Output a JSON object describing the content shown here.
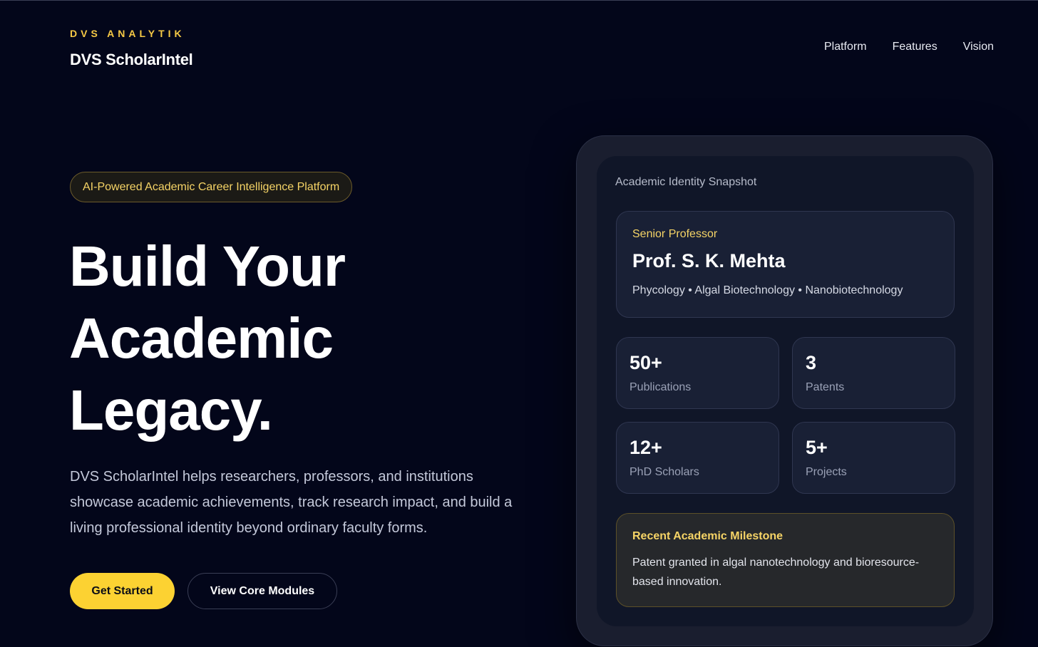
{
  "brand": {
    "eyebrow": "DVS ANALYTIK",
    "name": "DVS ScholarIntel"
  },
  "nav": {
    "items": [
      "Platform",
      "Features",
      "Vision"
    ]
  },
  "hero": {
    "pill": "AI-Powered Academic Career Intelligence Platform",
    "title_lines": [
      "Build Your",
      "Academic",
      "Legacy."
    ],
    "description": "DVS ScholarIntel helps researchers, professors, and institutions showcase academic achievements, track research impact, and build a living professional identity beyond ordinary faculty forms.",
    "primary_button": "Get Started",
    "secondary_button": "View Core Modules"
  },
  "snapshot": {
    "label": "Academic Identity Snapshot",
    "profile": {
      "role": "Senior Professor",
      "name": "Prof. S. K. Mehta",
      "fields": "Phycology • Algal Biotechnology • Nanobiotechnology"
    },
    "stats": [
      {
        "value": "50+",
        "label": "Publications"
      },
      {
        "value": "3",
        "label": "Patents"
      },
      {
        "value": "12+",
        "label": "PhD Scholars"
      },
      {
        "value": "5+",
        "label": "Projects"
      }
    ],
    "milestone": {
      "title": "Recent Academic Milestone",
      "text": "Patent granted in algal nanotechnology and bioresource-based innovation."
    }
  },
  "colors": {
    "background": "#03061a",
    "accent": "#fcd232",
    "accent_text": "#f6d466",
    "card": "#101628"
  }
}
